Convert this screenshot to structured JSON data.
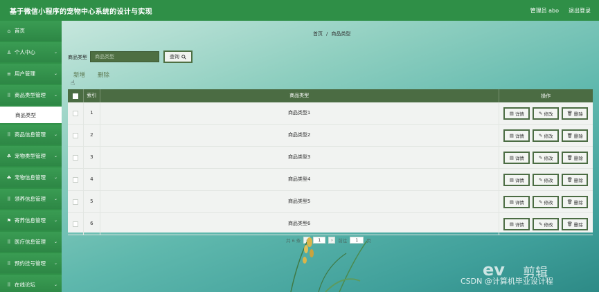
{
  "header": {
    "title": "基于微信小程序的宠物中心系统的设计与实现",
    "user_label": "管理员 abo",
    "logout_label": "退出登录"
  },
  "sidebar": {
    "items": [
      {
        "label": "首页",
        "icon": "home-icon"
      },
      {
        "label": "个人中心",
        "icon": "user-icon"
      },
      {
        "label": "用户管理",
        "icon": "list-icon"
      },
      {
        "label": "商品类型管理",
        "icon": "grid-icon"
      },
      {
        "label": "商品类型",
        "icon": "",
        "sub": true
      },
      {
        "label": "商品信息管理",
        "icon": "grid-icon"
      },
      {
        "label": "宠物类型管理",
        "icon": "pet-icon"
      },
      {
        "label": "宠物信息管理",
        "icon": "pet-icon"
      },
      {
        "label": "领养信息管理",
        "icon": "grid-icon"
      },
      {
        "label": "寄养信息管理",
        "icon": "flag-icon"
      },
      {
        "label": "医疗信息管理",
        "icon": "grid-icon"
      },
      {
        "label": "预约挂号管理",
        "icon": "grid-icon"
      },
      {
        "label": "在线论坛",
        "icon": "grid-icon"
      }
    ]
  },
  "breadcrumb": {
    "home": "首页",
    "current": "商品类型",
    "separator": "/"
  },
  "search": {
    "label": "商品类型",
    "placeholder": "商品类型",
    "button_label": "查询"
  },
  "actions": {
    "add_label": "新增",
    "delete_label": "删除"
  },
  "table": {
    "headers": {
      "index": "索引",
      "name": "商品类型",
      "ops": "操作"
    },
    "op_labels": {
      "detail": "详情",
      "edit": "修改",
      "delete": "删除"
    },
    "rows": [
      {
        "index": "1",
        "name": "商品类型1"
      },
      {
        "index": "2",
        "name": "商品类型2"
      },
      {
        "index": "3",
        "name": "商品类型3"
      },
      {
        "index": "4",
        "name": "商品类型4"
      },
      {
        "index": "5",
        "name": "商品类型5"
      },
      {
        "index": "6",
        "name": "商品类型6"
      }
    ]
  },
  "pagination": {
    "total_text": "共 6 条",
    "current_page": "1",
    "goto_label": "前往",
    "goto_value": "1",
    "page_suffix": "页"
  },
  "watermark": {
    "ev": "ev",
    "brand": "剪辑",
    "csdn": "CSDN @计算机毕业设计程"
  },
  "colors": {
    "header_bg": "#2f8f47",
    "table_header_bg": "#4b6c43",
    "accent": "#4e6f42"
  }
}
